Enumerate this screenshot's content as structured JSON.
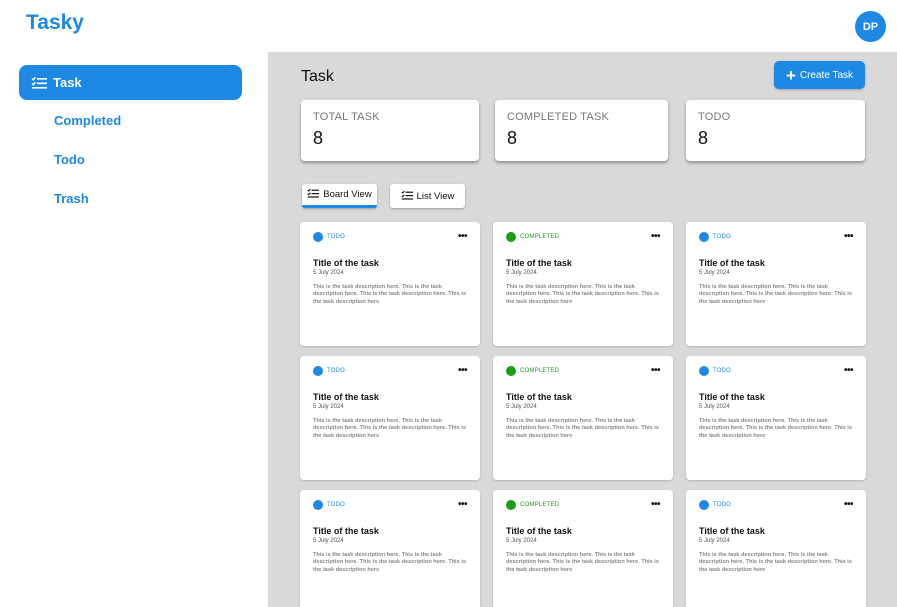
{
  "app": {
    "logo": "Tasky",
    "avatar_initials": "DP",
    "accent_color": "#1e88e5",
    "completed_color": "#1a9e1a"
  },
  "sidebar": {
    "items": [
      {
        "label": "Task",
        "icon": "task-list-icon",
        "active": true
      },
      {
        "label": "Completed",
        "active": false
      },
      {
        "label": "Todo",
        "active": false
      },
      {
        "label": "Trash",
        "active": false
      }
    ]
  },
  "main": {
    "title": "Task",
    "create_label": "Create Task",
    "stats": [
      {
        "label": "TOTAL TASK",
        "value": "8"
      },
      {
        "label": "COMPLETED TASK",
        "value": "8"
      },
      {
        "label": "TODO",
        "value": "8"
      }
    ],
    "views": [
      {
        "label": "Board View",
        "icon": "board-list-icon",
        "active": true
      },
      {
        "label": "List View",
        "icon": "list-icon",
        "active": false
      }
    ],
    "tasks": [
      {
        "status": "TODO",
        "title": "Title of the task",
        "date": "5 July 2024",
        "description": "This is the task description here. This is the task description here. This is the task description here. This is the task description here"
      },
      {
        "status": "COMPLETED",
        "title": "Title of the task",
        "date": "5 July 2024",
        "description": "This is the task description here. This is the task description here. This is the task description here. This is the task description here"
      },
      {
        "status": "TODO",
        "title": "Title of the task",
        "date": "5 July 2024",
        "description": "This is the task description here. This is the task description here. This is the task description here. This is the task description here"
      },
      {
        "status": "TODO",
        "title": "Title of the task",
        "date": "5 July 2024",
        "description": "This is the task description here. This is the task description here. This is the task description here. This is the task description here"
      },
      {
        "status": "COMPLETED",
        "title": "Title of the task",
        "date": "5 July 2024",
        "description": "This is the task description here. This is the task description here. This is the task description here. This is the task description here"
      },
      {
        "status": "TODO",
        "title": "Title of the task",
        "date": "5 July 2024",
        "description": "This is the task description here. This is the task description here. This is the task description here. This is the task description here"
      },
      {
        "status": "TODO",
        "title": "Title of the task",
        "date": "5 July 2024",
        "description": "This is the task description here. This is the task description here. This is the task description here. This is the task description here"
      },
      {
        "status": "COMPLETED",
        "title": "Title of the task",
        "date": "5 July 2024",
        "description": "This is the task description here. This is the task description here. This is the task description here. This is the task description here"
      },
      {
        "status": "TODO",
        "title": "Title of the task",
        "date": "5 July 2024",
        "description": "This is the task description here. This is the task description here. This is the task description here. This is the task description here"
      }
    ]
  }
}
